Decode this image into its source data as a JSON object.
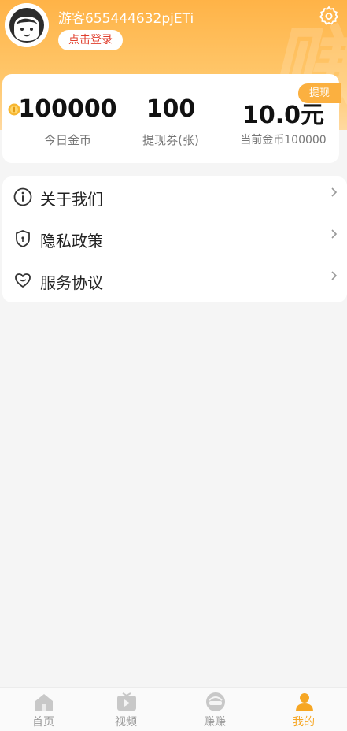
{
  "header": {
    "watermark": "赚",
    "username": "游客655444632pjETi",
    "login_label": "点击登录"
  },
  "stats": {
    "withdraw_label": "提现",
    "items": [
      {
        "value": "100000",
        "label": "今日金币"
      },
      {
        "value": "100",
        "label": "提现券(张)"
      },
      {
        "value": "10.0元",
        "label": "当前金币100000"
      }
    ]
  },
  "menu": {
    "items": [
      {
        "label": "关于我们",
        "icon": "info-icon"
      },
      {
        "label": "隐私政策",
        "icon": "shield-icon"
      },
      {
        "label": "服务协议",
        "icon": "heart-icon"
      }
    ]
  },
  "tabbar": {
    "items": [
      {
        "label": "首页",
        "icon": "home-icon",
        "active": false
      },
      {
        "label": "视频",
        "icon": "video-icon",
        "active": false
      },
      {
        "label": "赚赚",
        "icon": "earn-icon",
        "active": false
      },
      {
        "label": "我的",
        "icon": "profile-icon",
        "active": true
      }
    ]
  },
  "colors": {
    "accent": "#f6a623",
    "header_top": "#ffb347",
    "login_text": "#e0402f",
    "withdraw_tag": "#fbb040"
  }
}
